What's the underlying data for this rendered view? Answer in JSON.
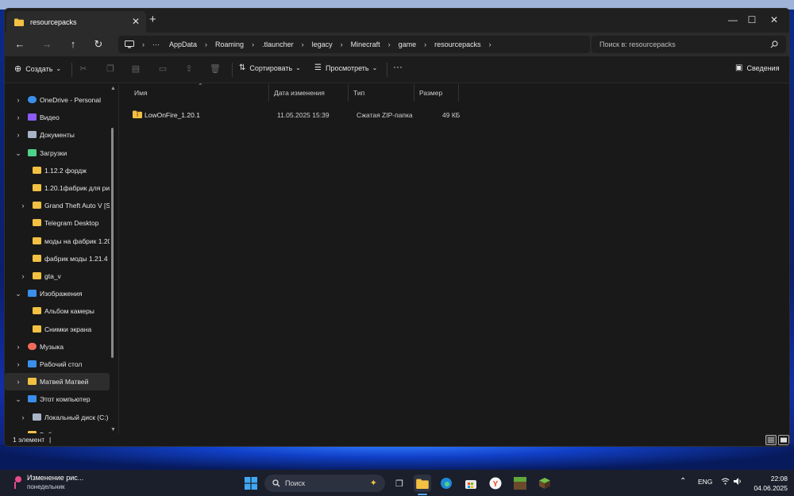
{
  "window": {
    "tab_title": "resourcepacks",
    "new_tab": "+",
    "close": "✕",
    "minimize": "—",
    "maximize": "☐",
    "window_close": "✕"
  },
  "nav": {
    "back": "←",
    "forward": "→",
    "up": "↑",
    "refresh": "↻",
    "more": "···",
    "breadcrumbs": [
      "AppData",
      "Roaming",
      ".tlauncher",
      "legacy",
      "Minecraft",
      "game",
      "resourcepacks"
    ],
    "search_placeholder": "Поиск в: resourcepacks"
  },
  "toolbar": {
    "create_label": "Создать",
    "sort_label": "Сортировать",
    "view_label": "Просмотреть",
    "more_label": "···",
    "details_label": "Сведения"
  },
  "sidebar": {
    "items": [
      {
        "label": "OneDrive - Personal",
        "level": 0,
        "chevron": "›",
        "icon": "cloud-icon"
      },
      {
        "label": "Видео",
        "level": 0,
        "chevron": "›",
        "icon": "video-icon"
      },
      {
        "label": "Документы",
        "level": 0,
        "chevron": "›",
        "icon": "document-icon"
      },
      {
        "label": "Загрузки",
        "level": 0,
        "chevron": "⌄",
        "icon": "download-icon"
      },
      {
        "label": "1.12.2 фордж",
        "level": 1,
        "chevron": "",
        "icon": "folder-icon"
      },
      {
        "label": "1.20.1фабрик для ри",
        "level": 1,
        "chevron": "",
        "icon": "folder-icon"
      },
      {
        "label": "Grand Theft Auto V [S",
        "level": 1,
        "chevron": "›",
        "icon": "folder-icon"
      },
      {
        "label": "Telegram Desktop",
        "level": 1,
        "chevron": "",
        "icon": "folder-icon"
      },
      {
        "label": "моды на фабрик 1.20",
        "level": 1,
        "chevron": "",
        "icon": "folder-icon"
      },
      {
        "label": "фабрик моды 1.21.4",
        "level": 1,
        "chevron": "",
        "icon": "folder-icon"
      },
      {
        "label": "gta_v",
        "level": 1,
        "chevron": "›",
        "icon": "folder-icon"
      },
      {
        "label": "Изображения",
        "level": 0,
        "chevron": "⌄",
        "icon": "image-icon"
      },
      {
        "label": "Альбом камеры",
        "level": 1,
        "chevron": "",
        "icon": "folder-icon"
      },
      {
        "label": "Снимки экрана",
        "level": 1,
        "chevron": "",
        "icon": "folder-icon"
      },
      {
        "label": "Музыка",
        "level": 0,
        "chevron": "›",
        "icon": "music-icon"
      },
      {
        "label": "Рабочий стол",
        "level": 0,
        "chevron": "›",
        "icon": "desktop-icon"
      },
      {
        "label": "Матвей Матвей",
        "level": 0,
        "chevron": "›",
        "icon": "folder-icon",
        "selected": true
      },
      {
        "label": "Этот компьютер",
        "level": 0,
        "chevron": "⌄",
        "icon": "computer-icon"
      },
      {
        "label": "Локальный диск (C:)",
        "level": 1,
        "chevron": "›",
        "icon": "drive-icon"
      },
      {
        "label": "Библиотеки",
        "level": 0,
        "chevron": "›",
        "icon": "folder-icon"
      }
    ]
  },
  "columns": [
    "Имя",
    "Дата изменения",
    "Тип",
    "Размер"
  ],
  "files": [
    {
      "name": "LowOnFire_1.20.1",
      "date": "11.05.2025 15:39",
      "type": "Сжатая ZIP-папка",
      "size": "49 КБ"
    }
  ],
  "status": {
    "count": "1 элемент",
    "separator": "|"
  },
  "taskbar": {
    "widget_title": "Изменение рис...",
    "widget_sub": "понедельник",
    "search_label": "Поиск",
    "language": "ENG",
    "time": "22:08",
    "date": "04.06.2025"
  },
  "colors": {
    "folder": "#f2c043",
    "accent": "#3b8eea"
  }
}
